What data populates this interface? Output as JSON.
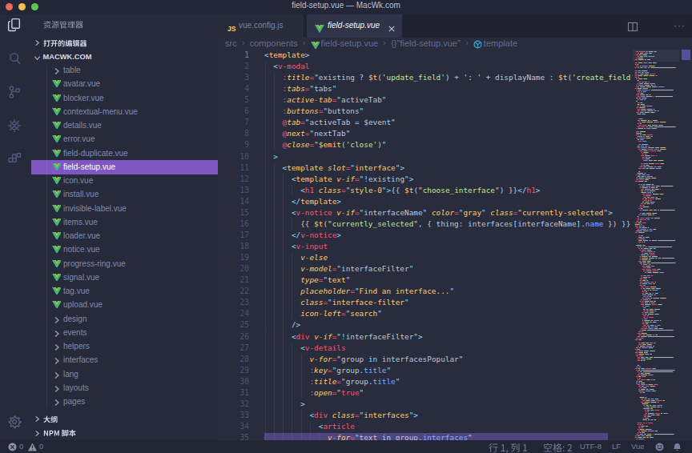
{
  "titlebar": {
    "title": "field-setup.vue — MacWk.com"
  },
  "activity_bar": {
    "top_icons": [
      {
        "name": "explorer",
        "active": true
      },
      {
        "name": "search",
        "active": false
      },
      {
        "name": "source-control",
        "active": false
      },
      {
        "name": "debug",
        "active": false
      },
      {
        "name": "extensions",
        "active": false
      }
    ],
    "bottom_icons": [
      {
        "name": "settings",
        "active": false
      }
    ]
  },
  "sidebar": {
    "title": "资源管理器",
    "sections": [
      {
        "label": "打开的编辑器",
        "collapsed": true
      },
      {
        "label": "MACWK.COM",
        "collapsed": false
      }
    ],
    "tree": [
      {
        "name": "table",
        "type": "folder"
      },
      {
        "name": "avatar.vue",
        "type": "vue"
      },
      {
        "name": "blocker.vue",
        "type": "vue"
      },
      {
        "name": "contextual-menu.vue",
        "type": "vue"
      },
      {
        "name": "details.vue",
        "type": "vue"
      },
      {
        "name": "error.vue",
        "type": "vue"
      },
      {
        "name": "field-duplicate.vue",
        "type": "vue"
      },
      {
        "name": "field-setup.vue",
        "type": "vue",
        "selected": true
      },
      {
        "name": "icon.vue",
        "type": "vue"
      },
      {
        "name": "install.vue",
        "type": "vue"
      },
      {
        "name": "invisible-label.vue",
        "type": "vue"
      },
      {
        "name": "items.vue",
        "type": "vue"
      },
      {
        "name": "loader.vue",
        "type": "vue"
      },
      {
        "name": "notice.vue",
        "type": "vue"
      },
      {
        "name": "progress-ring.vue",
        "type": "vue"
      },
      {
        "name": "signal.vue",
        "type": "vue"
      },
      {
        "name": "tag.vue",
        "type": "vue"
      },
      {
        "name": "upload.vue",
        "type": "vue"
      },
      {
        "name": "design",
        "type": "folder"
      },
      {
        "name": "events",
        "type": "folder"
      },
      {
        "name": "helpers",
        "type": "folder"
      },
      {
        "name": "interfaces",
        "type": "folder"
      },
      {
        "name": "lang",
        "type": "folder"
      },
      {
        "name": "layouts",
        "type": "folder"
      },
      {
        "name": "pages",
        "type": "folder"
      }
    ],
    "bottom_sections": [
      {
        "label": "大纲"
      },
      {
        "label": "NPM 脚本"
      }
    ]
  },
  "tabs": [
    {
      "icon": "js",
      "label": "vue.config.js",
      "active": false
    },
    {
      "icon": "vue",
      "label": "field-setup.vue",
      "active": true,
      "close_label": "×"
    }
  ],
  "editor_actions": [
    {
      "name": "split-editor"
    },
    {
      "name": "more-actions"
    }
  ],
  "breadcrumb": [
    {
      "label": "src"
    },
    {
      "label": "components"
    },
    {
      "label": "field-setup.vue",
      "icon": "vue"
    },
    {
      "label": "{}\"field-setup.vue\""
    },
    {
      "label": "template",
      "icon": "symbol"
    }
  ],
  "editor": {
    "lines": [
      [
        [
          "p",
          "<"
        ],
        [
          "y",
          "template"
        ],
        [
          "p",
          ">"
        ]
      ],
      [
        [
          "w",
          "  "
        ],
        [
          "p",
          "<"
        ],
        [
          "t",
          "v-modal"
        ]
      ],
      [
        [
          "w",
          "    "
        ],
        [
          "pk",
          ":"
        ],
        [
          "ai",
          "title"
        ],
        [
          "pk",
          "="
        ],
        [
          "p",
          "\""
        ],
        [
          "w",
          "existing "
        ],
        [
          "p",
          "?"
        ],
        [
          "w",
          " "
        ],
        [
          "y",
          "$t"
        ],
        [
          "w",
          "("
        ],
        [
          "g",
          "'update_field'"
        ],
        [
          "w",
          ")"
        ],
        [
          "w",
          " "
        ],
        [
          "p",
          "+"
        ],
        [
          "w",
          " "
        ],
        [
          "g",
          "': '"
        ],
        [
          "w",
          " "
        ],
        [
          "p",
          "+"
        ],
        [
          "w",
          " "
        ],
        [
          "w",
          "displayName "
        ],
        [
          "p",
          ":"
        ],
        [
          "w",
          " "
        ],
        [
          "y",
          "$t"
        ],
        [
          "w",
          "("
        ],
        [
          "g",
          "'create_field'"
        ],
        [
          "w",
          ")"
        ],
        [
          "p",
          "\""
        ]
      ],
      [
        [
          "w",
          "    "
        ],
        [
          "pk",
          ":"
        ],
        [
          "ai",
          "tabs"
        ],
        [
          "pk",
          "="
        ],
        [
          "p",
          "\""
        ],
        [
          "w",
          "tabs"
        ],
        [
          "p",
          "\""
        ]
      ],
      [
        [
          "w",
          "    "
        ],
        [
          "pk",
          ":"
        ],
        [
          "ai",
          "active-tab"
        ],
        [
          "pk",
          "="
        ],
        [
          "p",
          "\""
        ],
        [
          "w",
          "activeTab"
        ],
        [
          "p",
          "\""
        ]
      ],
      [
        [
          "w",
          "    "
        ],
        [
          "pk",
          ":"
        ],
        [
          "ai",
          "buttons"
        ],
        [
          "pk",
          "="
        ],
        [
          "p",
          "\""
        ],
        [
          "w",
          "buttons"
        ],
        [
          "p",
          "\""
        ]
      ],
      [
        [
          "w",
          "    "
        ],
        [
          "pk",
          "@"
        ],
        [
          "ai",
          "tab"
        ],
        [
          "pk",
          "="
        ],
        [
          "p",
          "\""
        ],
        [
          "w",
          "activeTab "
        ],
        [
          "p",
          "="
        ],
        [
          "w",
          " $event"
        ],
        [
          "p",
          "\""
        ]
      ],
      [
        [
          "w",
          "    "
        ],
        [
          "pk",
          "@"
        ],
        [
          "ai",
          "next"
        ],
        [
          "pk",
          "="
        ],
        [
          "p",
          "\""
        ],
        [
          "w",
          "nextTab"
        ],
        [
          "p",
          "\""
        ]
      ],
      [
        [
          "w",
          "    "
        ],
        [
          "pk",
          "@"
        ],
        [
          "ai",
          "close"
        ],
        [
          "pk",
          "="
        ],
        [
          "p",
          "\""
        ],
        [
          "y",
          "$emit"
        ],
        [
          "w",
          "("
        ],
        [
          "g",
          "'close'"
        ],
        [
          "w",
          ")"
        ],
        [
          "p",
          "\""
        ]
      ],
      [
        [
          "w",
          "  "
        ],
        [
          "p",
          ">"
        ]
      ],
      [
        [
          "w",
          "    "
        ],
        [
          "p",
          "<"
        ],
        [
          "y",
          "template"
        ],
        [
          "w",
          " "
        ],
        [
          "ai",
          "slot"
        ],
        [
          "pk",
          "="
        ],
        [
          "p",
          "\""
        ],
        [
          "y",
          "interface"
        ],
        [
          "p",
          "\""
        ],
        [
          "p",
          ">"
        ]
      ],
      [
        [
          "w",
          "      "
        ],
        [
          "p",
          "<"
        ],
        [
          "y",
          "template"
        ],
        [
          "w",
          " "
        ],
        [
          "ai",
          "v-if"
        ],
        [
          "pk",
          "="
        ],
        [
          "p",
          "\""
        ],
        [
          "p",
          "!"
        ],
        [
          "w",
          "existing"
        ],
        [
          "p",
          "\""
        ],
        [
          "p",
          ">"
        ]
      ],
      [
        [
          "w",
          "        "
        ],
        [
          "p",
          "<"
        ],
        [
          "t",
          "h1"
        ],
        [
          "w",
          " "
        ],
        [
          "ai",
          "class"
        ],
        [
          "pk",
          "="
        ],
        [
          "p",
          "\""
        ],
        [
          "y",
          "style-0"
        ],
        [
          "p",
          "\""
        ],
        [
          "p",
          ">"
        ],
        [
          "w",
          "{{ "
        ],
        [
          "y",
          "$t"
        ],
        [
          "w",
          "("
        ],
        [
          "g",
          "\"choose_interface\""
        ],
        [
          "w",
          ")"
        ],
        [
          "w",
          " }}"
        ],
        [
          "p",
          "</"
        ],
        [
          "t",
          "h1"
        ],
        [
          "p",
          ">"
        ]
      ],
      [
        [
          "w",
          "      "
        ],
        [
          "p",
          "</"
        ],
        [
          "y",
          "template"
        ],
        [
          "p",
          ">"
        ]
      ],
      [
        [
          "w",
          "      "
        ],
        [
          "p",
          "<"
        ],
        [
          "t",
          "v-notice"
        ],
        [
          "w",
          " "
        ],
        [
          "ai",
          "v-if"
        ],
        [
          "pk",
          "="
        ],
        [
          "p",
          "\""
        ],
        [
          "w",
          "interfaceName"
        ],
        [
          "p",
          "\""
        ],
        [
          "w",
          " "
        ],
        [
          "ai",
          "color"
        ],
        [
          "pk",
          "="
        ],
        [
          "p",
          "\""
        ],
        [
          "y",
          "gray"
        ],
        [
          "p",
          "\""
        ],
        [
          "w",
          " "
        ],
        [
          "ai",
          "class"
        ],
        [
          "pk",
          "="
        ],
        [
          "p",
          "\""
        ],
        [
          "y",
          "currently-selected"
        ],
        [
          "p",
          "\""
        ],
        [
          "p",
          ">"
        ]
      ],
      [
        [
          "w",
          "        "
        ],
        [
          "w",
          "{{ "
        ],
        [
          "y",
          "$t"
        ],
        [
          "w",
          "("
        ],
        [
          "g",
          "\"currently_selected\""
        ],
        [
          "p",
          ","
        ],
        [
          "w",
          " { thing"
        ],
        [
          "p",
          ":"
        ],
        [
          "w",
          " interfaces"
        ],
        [
          "p",
          "["
        ],
        [
          "w",
          "interfaceName"
        ],
        [
          "p",
          "]"
        ],
        [
          "p",
          "."
        ],
        [
          "b",
          "name"
        ],
        [
          "w",
          " }) }}"
        ]
      ],
      [
        [
          "w",
          "      "
        ],
        [
          "p",
          "</"
        ],
        [
          "t",
          "v-notice"
        ],
        [
          "p",
          ">"
        ]
      ],
      [
        [
          "w",
          "      "
        ],
        [
          "p",
          "<"
        ],
        [
          "t",
          "v-input"
        ]
      ],
      [
        [
          "w",
          "        "
        ],
        [
          "ai",
          "v-else"
        ]
      ],
      [
        [
          "w",
          "        "
        ],
        [
          "ai",
          "v-model"
        ],
        [
          "pk",
          "="
        ],
        [
          "p",
          "\""
        ],
        [
          "w",
          "interfaceFilter"
        ],
        [
          "p",
          "\""
        ]
      ],
      [
        [
          "w",
          "        "
        ],
        [
          "ai",
          "type"
        ],
        [
          "pk",
          "="
        ],
        [
          "p",
          "\""
        ],
        [
          "y",
          "text"
        ],
        [
          "p",
          "\""
        ]
      ],
      [
        [
          "w",
          "        "
        ],
        [
          "ai",
          "placeholder"
        ],
        [
          "pk",
          "="
        ],
        [
          "p",
          "\""
        ],
        [
          "y",
          "Find an interface..."
        ],
        [
          "p",
          "\""
        ]
      ],
      [
        [
          "w",
          "        "
        ],
        [
          "ai",
          "class"
        ],
        [
          "pk",
          "="
        ],
        [
          "p",
          "\""
        ],
        [
          "y",
          "interface-filter"
        ],
        [
          "p",
          "\""
        ]
      ],
      [
        [
          "w",
          "        "
        ],
        [
          "ai",
          "icon-left"
        ],
        [
          "pk",
          "="
        ],
        [
          "p",
          "\""
        ],
        [
          "y",
          "search"
        ],
        [
          "p",
          "\""
        ]
      ],
      [
        [
          "w",
          "      "
        ],
        [
          "p",
          "/>"
        ]
      ],
      [
        [
          "w",
          "      "
        ],
        [
          "p",
          "<"
        ],
        [
          "t",
          "div"
        ],
        [
          "w",
          " "
        ],
        [
          "ai",
          "v-if"
        ],
        [
          "pk",
          "="
        ],
        [
          "p",
          "\""
        ],
        [
          "p",
          "!"
        ],
        [
          "w",
          "interfaceFilter"
        ],
        [
          "p",
          "\""
        ],
        [
          "p",
          ">"
        ]
      ],
      [
        [
          "w",
          "        "
        ],
        [
          "p",
          "<"
        ],
        [
          "t",
          "v-details"
        ]
      ],
      [
        [
          "w",
          "          "
        ],
        [
          "ai",
          "v-for"
        ],
        [
          "pk",
          "="
        ],
        [
          "p",
          "\""
        ],
        [
          "w",
          "group "
        ],
        [
          "p",
          "in"
        ],
        [
          "w",
          " interfacesPopular"
        ],
        [
          "p",
          "\""
        ]
      ],
      [
        [
          "w",
          "          "
        ],
        [
          "pk",
          ":"
        ],
        [
          "ai",
          "key"
        ],
        [
          "pk",
          "="
        ],
        [
          "p",
          "\""
        ],
        [
          "w",
          "group"
        ],
        [
          "p",
          "."
        ],
        [
          "b",
          "title"
        ],
        [
          "p",
          "\""
        ]
      ],
      [
        [
          "w",
          "          "
        ],
        [
          "pk",
          ":"
        ],
        [
          "ai",
          "title"
        ],
        [
          "pk",
          "="
        ],
        [
          "p",
          "\""
        ],
        [
          "w",
          "group"
        ],
        [
          "p",
          "."
        ],
        [
          "b",
          "title"
        ],
        [
          "p",
          "\""
        ]
      ],
      [
        [
          "w",
          "          "
        ],
        [
          "pk",
          ":"
        ],
        [
          "ai",
          "open"
        ],
        [
          "pk",
          "="
        ],
        [
          "p",
          "\""
        ],
        [
          "pk",
          "true"
        ],
        [
          "p",
          "\""
        ]
      ],
      [
        [
          "w",
          "        "
        ],
        [
          "p",
          ">"
        ]
      ],
      [
        [
          "w",
          "          "
        ],
        [
          "p",
          "<"
        ],
        [
          "t",
          "div"
        ],
        [
          "w",
          " "
        ],
        [
          "ai",
          "class"
        ],
        [
          "pk",
          "="
        ],
        [
          "p",
          "\""
        ],
        [
          "y",
          "interfaces"
        ],
        [
          "p",
          "\""
        ],
        [
          "p",
          ">"
        ]
      ],
      [
        [
          "w",
          "            "
        ],
        [
          "p",
          "<"
        ],
        [
          "t",
          "article"
        ]
      ],
      [
        [
          "w",
          "              "
        ],
        [
          "ai",
          "v-for"
        ],
        [
          "pk",
          "="
        ],
        [
          "p",
          "\""
        ],
        [
          "w",
          "text "
        ],
        [
          "p",
          "in"
        ],
        [
          "w",
          " group"
        ],
        [
          "p",
          "."
        ],
        [
          "b",
          "interfaces"
        ],
        [
          "p",
          "\""
        ]
      ]
    ]
  },
  "status_bar": {
    "errors": "0",
    "warnings": "0",
    "line_col": "行 1, 列 1",
    "spaces": "空格: 2",
    "encoding": "UTF-8",
    "eol": "LF",
    "language": "Vue",
    "icons": [
      "error",
      "warning",
      "feedback",
      "bell"
    ]
  },
  "colors": {
    "accent_purple": "#7e57c2",
    "vue_green": "#41b883",
    "vue_lime": "#9ccb3b",
    "js_yellow": "#ffd351",
    "editor_bg": "#282c3d"
  }
}
